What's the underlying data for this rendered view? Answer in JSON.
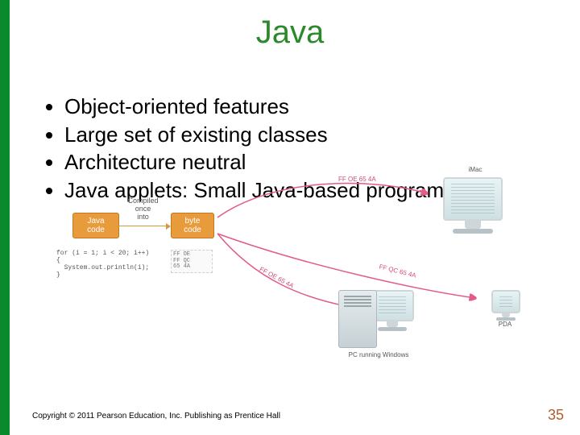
{
  "title": "Java",
  "bullets": [
    "Object-oriented features",
    "Large set of existing classes",
    "Architecture neutral",
    "Java applets: Small Java-based programs"
  ],
  "diagram": {
    "box_java_code": "Java\ncode",
    "compiled_label": "Compiled\nonce\ninto",
    "box_byte_code": "byte\ncode",
    "code_snippet": "for (i = 1; i < 20; i++)\n{\n  System.out.println(i);\n}",
    "bytecode_snippet": "FF OE\nFF QC\n65 4A",
    "arrow1_label": "FF OE 65 4A",
    "arrow2_label": "FF OE 65 4A",
    "arrow3_label": "FF QC 65 4A",
    "comp1_label": "iMac",
    "comp2_label": "PC running Windows",
    "comp3_label": "PDA"
  },
  "footer": {
    "copyright": "Copyright © 2011 Pearson Education, Inc. Publishing as Prentice Hall",
    "page": "35"
  }
}
